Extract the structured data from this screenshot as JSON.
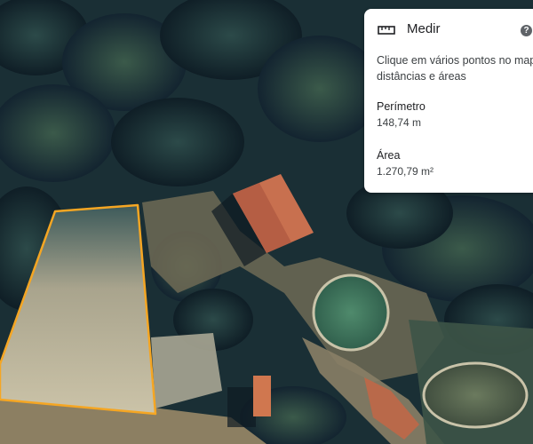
{
  "map": {
    "view": "satellite",
    "measure_outline_color": "#f5a623"
  },
  "panel": {
    "icon": "ruler-icon",
    "title": "Medir",
    "help_icon": "help-icon",
    "help_glyph": "?",
    "instructions_line1": "Clique em vários pontos no mapa",
    "instructions_line2": "distâncias e áreas",
    "perimeter_label": "Perímetro",
    "perimeter_value": "148,74 m",
    "area_label": "Área",
    "area_value": "1.270,79 m²"
  }
}
